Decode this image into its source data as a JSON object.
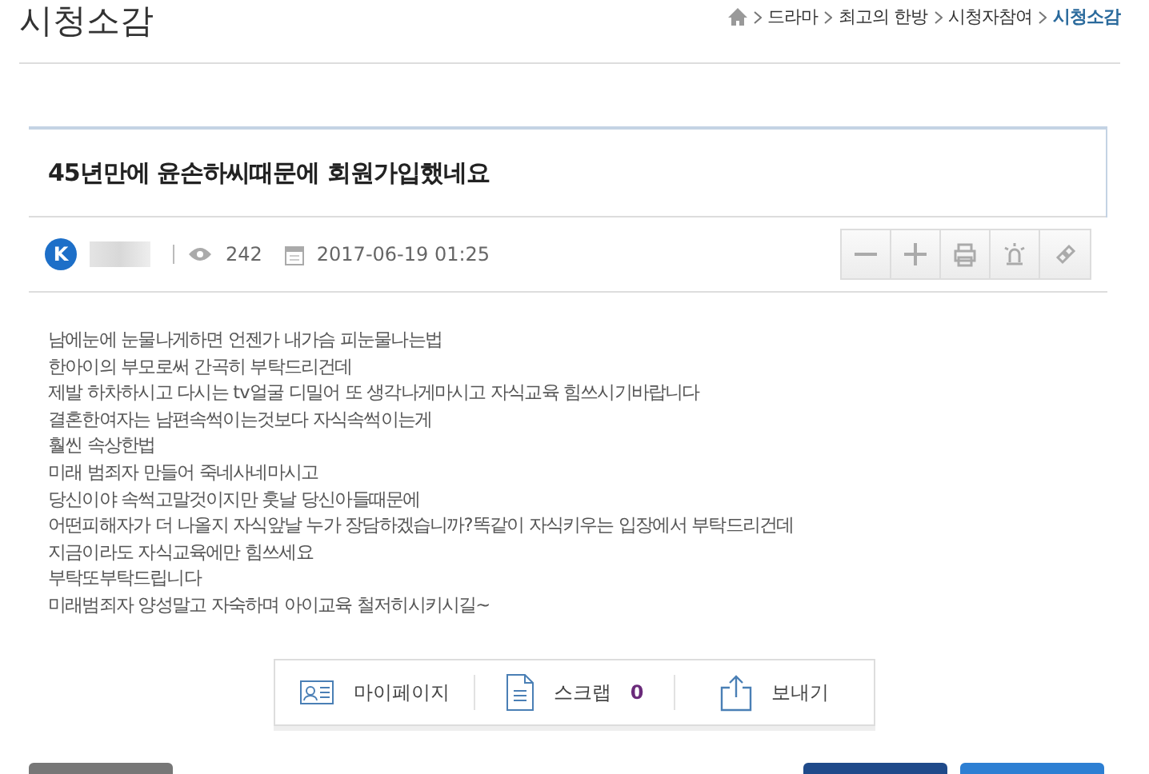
{
  "header": {
    "title": "시청소감",
    "breadcrumb": [
      {
        "label": "드라마",
        "selected": false
      },
      {
        "label": "최고의 한방",
        "selected": false
      },
      {
        "label": "시청자참여",
        "selected": false
      },
      {
        "label": "시청소감",
        "selected": true
      }
    ]
  },
  "post": {
    "title": "45년만에 윤손하씨때문에 회원가입했네요",
    "author_initial": "K",
    "views": "242",
    "date": "2017-06-19 01:25",
    "tools": [
      {
        "kind": "minus"
      },
      {
        "kind": "plus"
      },
      {
        "kind": "print"
      },
      {
        "kind": "siren"
      },
      {
        "kind": "link"
      }
    ],
    "body": [
      "남에눈에 눈물나게하면 언젠가 내가슴 피눈물나는법",
      "한아이의 부모로써 간곡히 부탁드리건데",
      "제발 하차하시고 다시는 tv얼굴 디밀어 또 생각나게마시고 자식교육 힘쓰시기바랍니다",
      "결혼한여자는 남편속썩이는것보다 자식속썩이는게",
      "훨씬 속상한법",
      "미래 범죄자 만들어 죽네사네마시고",
      "당신이야 속썩고말것이지만 훗날 당신아들때문에",
      "어떤피해자가 더 나올지 자식앞날 누가 장담하겠습니까?똑같이 자식키우는 입장에서 부탁드리건데",
      "지금이라도 자식교육에만 힘쓰세요",
      "부탁또부탁드립니다",
      "미래범죄자 양성말고 자숙하며 아이교육 철저히시키시길~"
    ]
  },
  "actions": [
    {
      "kind": "mypage",
      "label": "마이페이지"
    },
    {
      "kind": "scrap",
      "label": "스크랩",
      "count": "0"
    },
    {
      "kind": "share",
      "label": "보내기"
    }
  ],
  "bottom_buttons": [
    {
      "color": "#777777"
    },
    {
      "color": "#1f4a8a"
    },
    {
      "color": "#2d7fd3"
    }
  ]
}
